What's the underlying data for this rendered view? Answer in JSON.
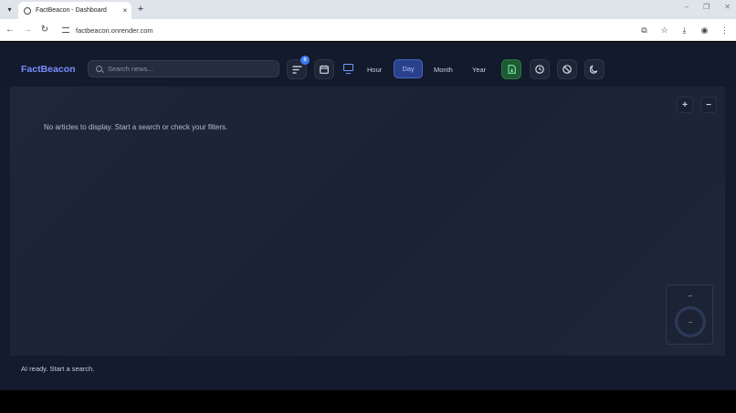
{
  "browser": {
    "tab_title": "FactBeacon - Dashboard",
    "tab_close": "×",
    "new_tab": "+",
    "url": "factbeacon.onrender.com",
    "window_controls": [
      "–",
      "❐",
      "✕"
    ]
  },
  "app": {
    "logo": "FactBeacon",
    "search": {
      "placeholder": "Search news..."
    },
    "filter_badge": "0",
    "time_ranges": [
      "Hour",
      "Day",
      "Month",
      "Year"
    ],
    "selected_range": "Day",
    "zoom_in": "+",
    "zoom_out": "−",
    "empty_message": "No articles to display. Start a search or check your filters.",
    "gauge": {
      "top_value": "--",
      "center_value": "--"
    },
    "status": "AI ready. Start a search."
  },
  "colors": {
    "accent": "#7a8cff",
    "active_range_bg": "#28418a",
    "export_button": "#1d5a32",
    "badge": "#3b7cf2"
  },
  "icons": [
    "filter-icon",
    "calendar-icon",
    "monitor-icon",
    "export-icon",
    "clock-icon",
    "block-icon",
    "moon-icon",
    "search-icon"
  ]
}
